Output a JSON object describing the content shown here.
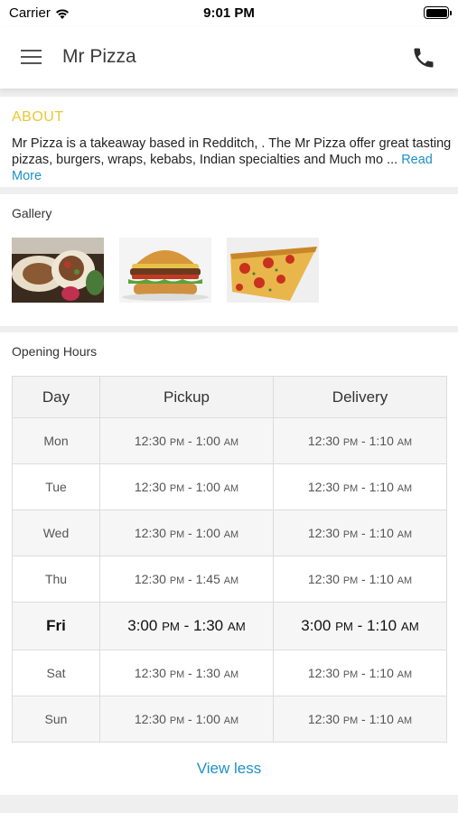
{
  "status_bar": {
    "carrier": "Carrier",
    "time": "9:01 PM"
  },
  "nav": {
    "title": "Mr Pizza",
    "menu_icon": "hamburger-menu-icon",
    "phone_icon": "phone-icon"
  },
  "about": {
    "title": "ABOUT",
    "text": "Mr Pizza is a takeaway based in Redditch, . The Mr Pizza offer great tasting pizzas, burgers, wraps, kebabs, Indian specialties and Much mo ...",
    "read_more": "Read More"
  },
  "gallery": {
    "title": "Gallery",
    "images": [
      "wrap-photo",
      "burger-photo",
      "pizza-photo"
    ]
  },
  "opening_hours": {
    "title": "Opening Hours",
    "columns": [
      "Day",
      "Pickup",
      "Delivery"
    ],
    "rows": [
      {
        "day": "Mon",
        "pickup_open": "12:30",
        "pickup_open_ap": "PM",
        "pickup_close": "1:00",
        "pickup_close_ap": "AM",
        "delivery_open": "12:30",
        "delivery_open_ap": "PM",
        "delivery_close": "1:10",
        "delivery_close_ap": "AM"
      },
      {
        "day": "Tue",
        "pickup_open": "12:30",
        "pickup_open_ap": "PM",
        "pickup_close": "1:00",
        "pickup_close_ap": "AM",
        "delivery_open": "12:30",
        "delivery_open_ap": "PM",
        "delivery_close": "1:10",
        "delivery_close_ap": "AM"
      },
      {
        "day": "Wed",
        "pickup_open": "12:30",
        "pickup_open_ap": "PM",
        "pickup_close": "1:00",
        "pickup_close_ap": "AM",
        "delivery_open": "12:30",
        "delivery_open_ap": "PM",
        "delivery_close": "1:10",
        "delivery_close_ap": "AM"
      },
      {
        "day": "Thu",
        "pickup_open": "12:30",
        "pickup_open_ap": "PM",
        "pickup_close": "1:45",
        "pickup_close_ap": "AM",
        "delivery_open": "12:30",
        "delivery_open_ap": "PM",
        "delivery_close": "1:10",
        "delivery_close_ap": "AM"
      },
      {
        "day": "Fri",
        "pickup_open": "3:00",
        "pickup_open_ap": "PM",
        "pickup_close": "1:30",
        "pickup_close_ap": "AM",
        "delivery_open": "3:00",
        "delivery_open_ap": "PM",
        "delivery_close": "1:10",
        "delivery_close_ap": "AM"
      },
      {
        "day": "Sat",
        "pickup_open": "12:30",
        "pickup_open_ap": "PM",
        "pickup_close": "1:30",
        "pickup_close_ap": "AM",
        "delivery_open": "12:30",
        "delivery_open_ap": "PM",
        "delivery_close": "1:10",
        "delivery_close_ap": "AM"
      },
      {
        "day": "Sun",
        "pickup_open": "12:30",
        "pickup_open_ap": "PM",
        "pickup_close": "1:00",
        "pickup_close_ap": "AM",
        "delivery_open": "12:30",
        "delivery_open_ap": "PM",
        "delivery_close": "1:10",
        "delivery_close_ap": "AM"
      }
    ],
    "highlighted_day": "Fri",
    "view_less": "View less"
  },
  "colors": {
    "about_title": "#e8c830",
    "link": "#1e90c8"
  }
}
